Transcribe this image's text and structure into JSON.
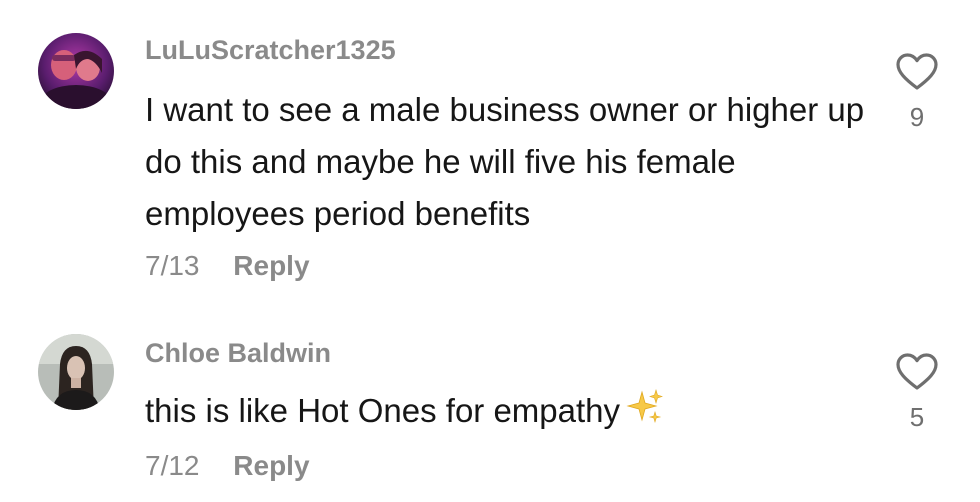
{
  "comments": [
    {
      "username": "LuLuScratcher1325",
      "text": "I want to see a male business owner or higher up do this and maybe he will five his female employees period benefits",
      "date": "7/13",
      "reply_label": "Reply",
      "like_count": "9",
      "avatar_icon": "photo-two-people-purple-light"
    },
    {
      "username": "Chloe Baldwin",
      "text": "this is like Hot Ones for empathy",
      "emoji": "sparkles-icon",
      "date": "7/12",
      "reply_label": "Reply",
      "like_count": "5",
      "avatar_icon": "photo-person-dark-hair"
    }
  ],
  "colors": {
    "username": "#8a8a8a",
    "text": "#161616",
    "meta": "#8a8a8a",
    "heart_stroke": "#6f6f6f",
    "sparkle": "#f7c948"
  }
}
